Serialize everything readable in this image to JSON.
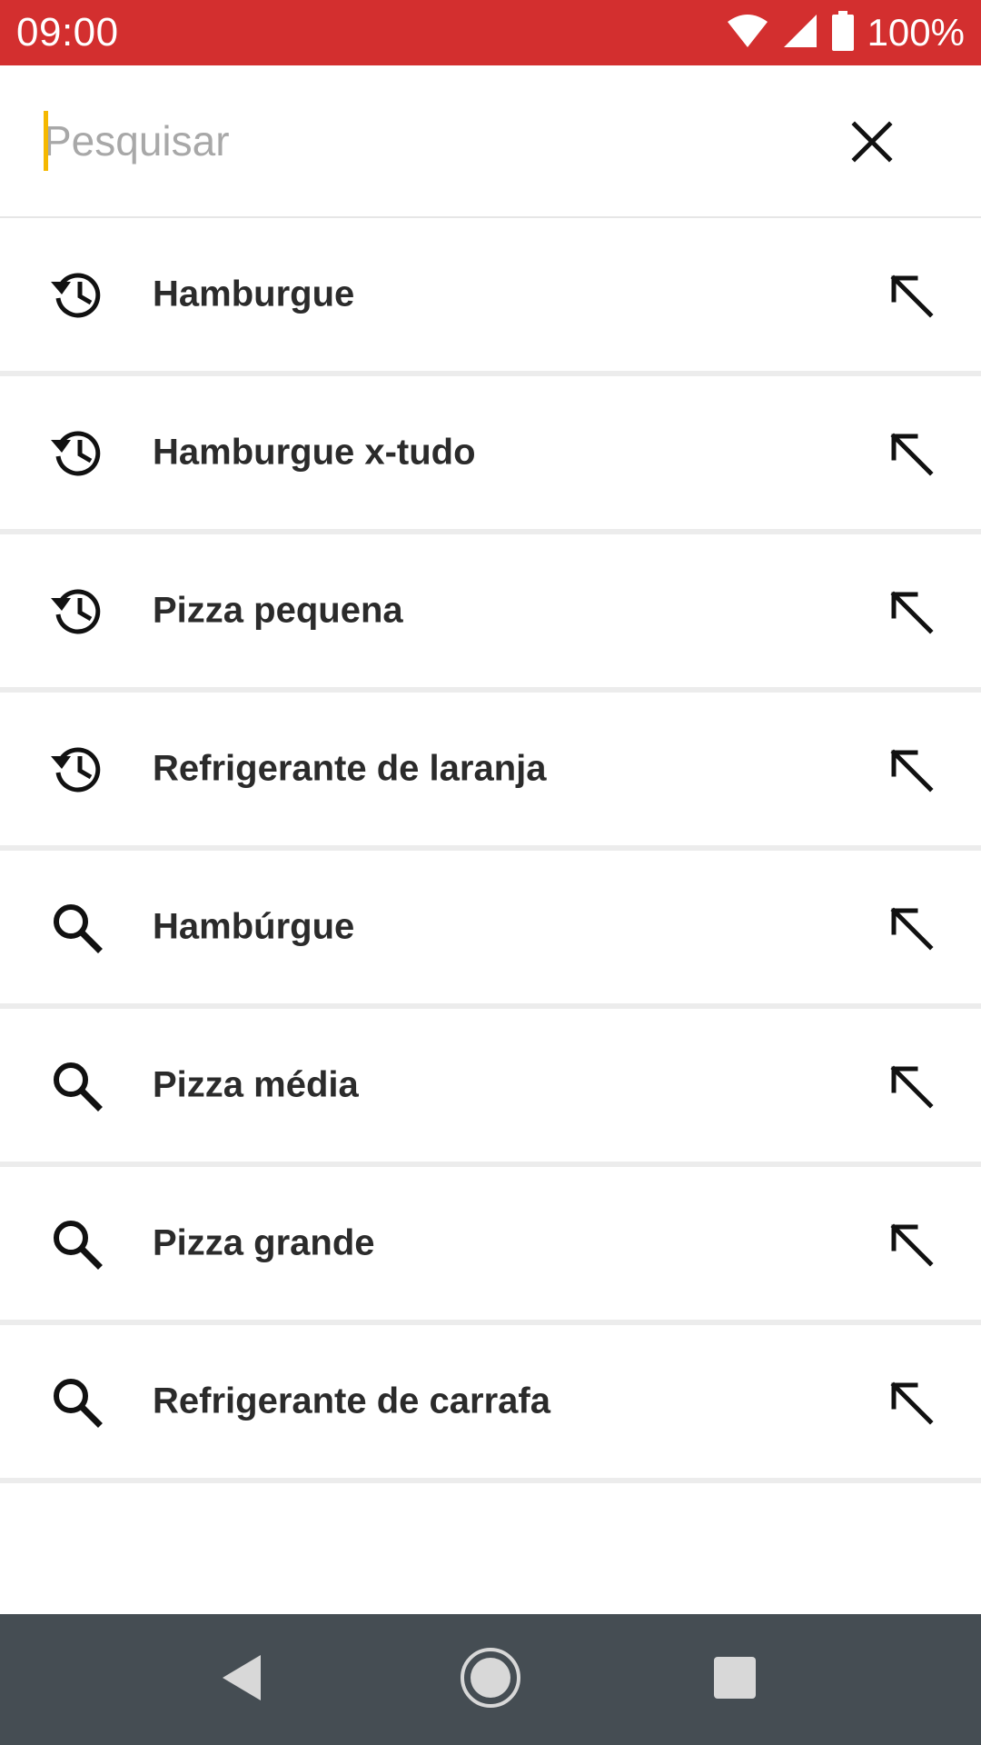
{
  "status_bar": {
    "time": "09:00",
    "battery": "100%",
    "icons": [
      "wifi-icon",
      "signal-icon",
      "battery-icon"
    ]
  },
  "search": {
    "placeholder": "Pesquisar",
    "value": ""
  },
  "suggestions": [
    {
      "type": "history",
      "icon": "history-icon",
      "label": "Hamburgue"
    },
    {
      "type": "history",
      "icon": "history-icon",
      "label": "Hamburgue x-tudo"
    },
    {
      "type": "history",
      "icon": "history-icon",
      "label": "Pizza pequena"
    },
    {
      "type": "history",
      "icon": "history-icon",
      "label": "Refrigerante de laranja"
    },
    {
      "type": "suggestion",
      "icon": "search-icon",
      "label": "Hambúrgue"
    },
    {
      "type": "suggestion",
      "icon": "search-icon",
      "label": "Pizza média"
    },
    {
      "type": "suggestion",
      "icon": "search-icon",
      "label": "Pizza grande"
    },
    {
      "type": "suggestion",
      "icon": "search-icon",
      "label": "Refrigerante de carrafa"
    }
  ],
  "nav_bar": {
    "buttons": [
      "back-icon",
      "home-icon",
      "recents-icon"
    ]
  },
  "colors": {
    "status_bar": "#d32f2f",
    "cursor": "#f5b800",
    "nav_bar": "#454d53",
    "text": "#2b2b2b",
    "placeholder": "#a8a8a8"
  }
}
